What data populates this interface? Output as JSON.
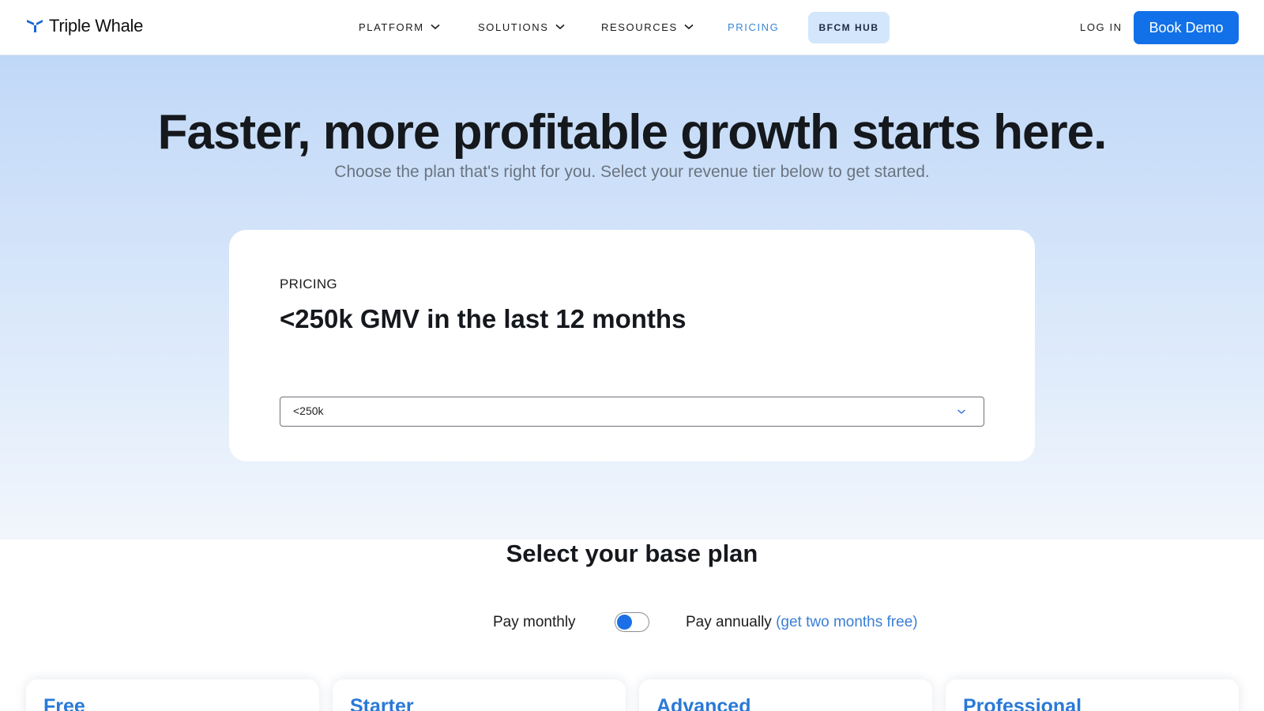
{
  "header": {
    "brand": "Triple Whale",
    "nav": [
      {
        "label": "PLATFORM",
        "has_dropdown": true
      },
      {
        "label": "SOLUTIONS",
        "has_dropdown": true
      },
      {
        "label": "RESOURCES",
        "has_dropdown": true
      },
      {
        "label": "PRICING",
        "has_dropdown": false,
        "active": true
      }
    ],
    "bfcm_label": "BFCM HUB",
    "login_label": "LOG IN",
    "demo_label": "Book Demo"
  },
  "hero": {
    "title": "Faster, more profitable growth starts here.",
    "subtitle": "Choose the plan that's right for you. Select your revenue tier below to get started."
  },
  "pricing_card": {
    "eyebrow": "PRICING",
    "title": "<250k GMV in the last 12 months",
    "tier_selected": "<250k"
  },
  "plans": {
    "heading": "Select your base plan",
    "billing": {
      "monthly_label": "Pay monthly",
      "annual_label": "Pay annually",
      "annual_note": "(get two months free)",
      "selected": "monthly"
    },
    "cards": [
      {
        "name": "Free"
      },
      {
        "name": "Starter"
      },
      {
        "name": "Advanced"
      },
      {
        "name": "Professional"
      }
    ]
  },
  "colors": {
    "accent": "#1271e8",
    "link": "#3a86d8",
    "hub_bg": "#d3e6fb",
    "plan_name": "#2a79d6"
  }
}
